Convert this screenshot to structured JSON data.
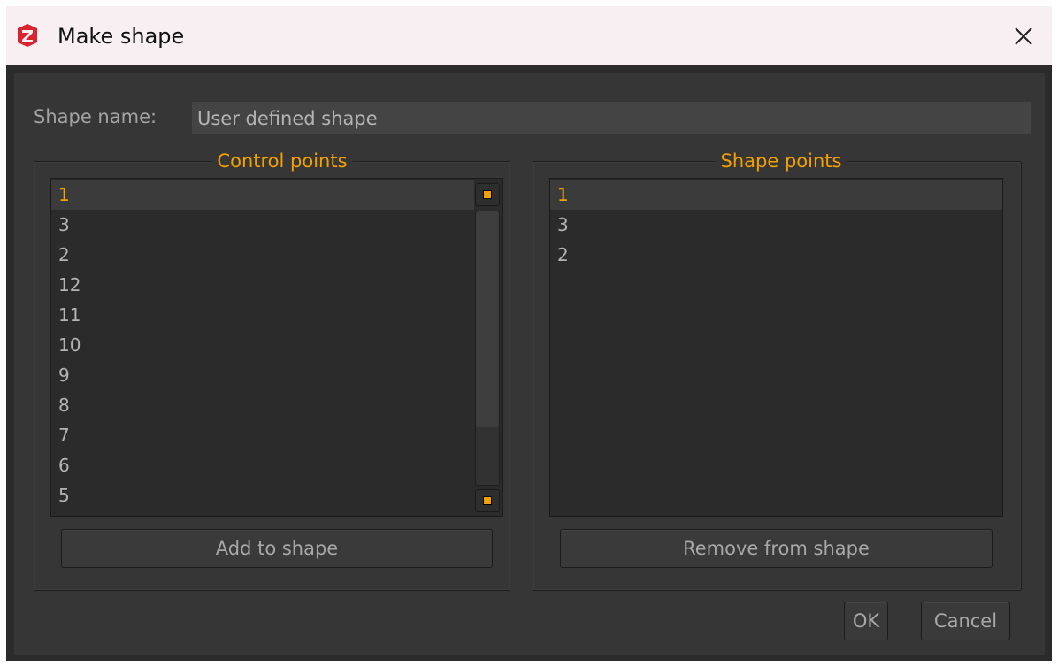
{
  "window": {
    "title": "Make shape",
    "app_icon": "app-logo-icon",
    "close_icon": "close-icon"
  },
  "form": {
    "name_label": "Shape name:",
    "name_value": "User defined shape"
  },
  "control_points": {
    "title": "Control points",
    "items": [
      "1",
      "3",
      "2",
      "12",
      "11",
      "10",
      "9",
      "8",
      "7",
      "6",
      "5"
    ],
    "selected": "1",
    "add_button": "Add to shape"
  },
  "shape_points": {
    "title": "Shape points",
    "items": [
      "1",
      "3",
      "2"
    ],
    "selected": "1",
    "remove_button": "Remove from shape"
  },
  "footer": {
    "ok_label": "OK",
    "cancel_label": "Cancel"
  },
  "colors": {
    "accent": "#f2a100",
    "background": "#363636",
    "list_bg": "#2b2b2b"
  }
}
